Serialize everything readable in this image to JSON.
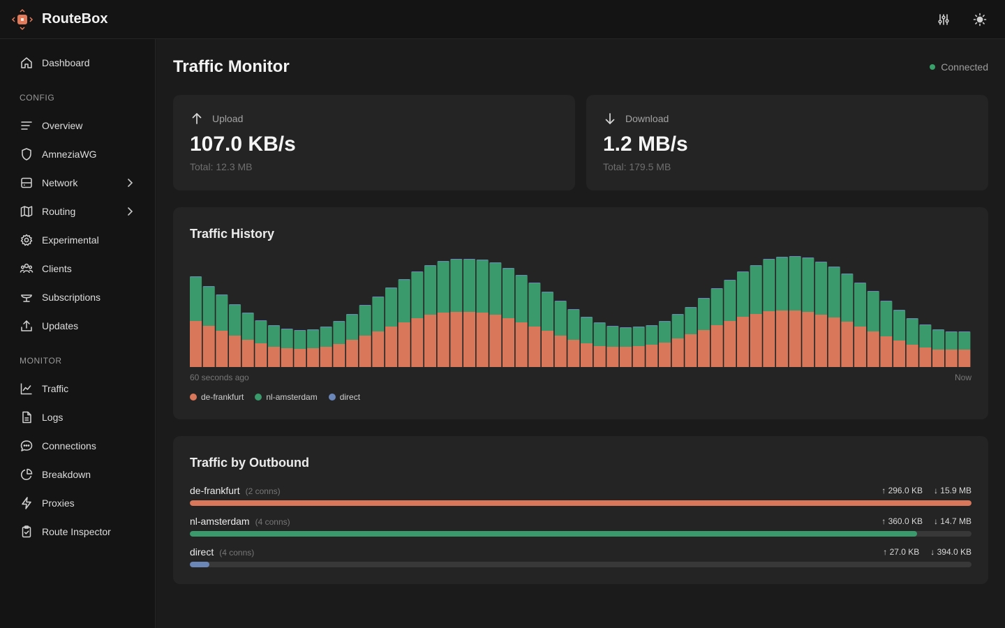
{
  "app": {
    "name": "RouteBox",
    "logo_icon": "routebox-logo-icon",
    "accent": "#e07a5a"
  },
  "topbar": {
    "actions": [
      {
        "icon": "sliders-icon"
      },
      {
        "icon": "sun-icon"
      }
    ]
  },
  "sidebar": {
    "top_items": [
      {
        "label": "Dashboard",
        "icon": "home-icon"
      }
    ],
    "sections": [
      {
        "title": "CONFIG",
        "items": [
          {
            "label": "Overview",
            "icon": "list-icon",
            "chevron": false
          },
          {
            "label": "AmneziaWG",
            "icon": "shield-icon",
            "chevron": false
          },
          {
            "label": "Network",
            "icon": "server-icon",
            "chevron": true
          },
          {
            "label": "Routing",
            "icon": "map-icon",
            "chevron": true
          },
          {
            "label": "Experimental",
            "icon": "gear-icon",
            "chevron": false
          },
          {
            "label": "Clients",
            "icon": "users-icon",
            "chevron": false
          },
          {
            "label": "Subscriptions",
            "icon": "cup-icon",
            "chevron": false
          },
          {
            "label": "Updates",
            "icon": "upload-icon",
            "chevron": false
          }
        ]
      },
      {
        "title": "MONITOR",
        "items": [
          {
            "label": "Traffic",
            "icon": "chart-line-icon",
            "chevron": false
          },
          {
            "label": "Logs",
            "icon": "file-icon",
            "chevron": false
          },
          {
            "label": "Connections",
            "icon": "chat-icon",
            "chevron": false
          },
          {
            "label": "Breakdown",
            "icon": "pie-chart-icon",
            "chevron": false
          },
          {
            "label": "Proxies",
            "icon": "bolt-icon",
            "chevron": false
          },
          {
            "label": "Route Inspector",
            "icon": "clipboard-check-icon",
            "chevron": false
          }
        ]
      }
    ]
  },
  "main": {
    "title": "Traffic Monitor",
    "status": {
      "label": "Connected",
      "color": "#3aa06b"
    },
    "upload": {
      "label": "Upload",
      "value": "107.0 KB/s",
      "total": "Total: 12.3 MB",
      "icon": "arrow-up-icon"
    },
    "download": {
      "label": "Download",
      "value": "1.2 MB/s",
      "total": "Total: 179.5 MB",
      "icon": "arrow-down-icon"
    },
    "history": {
      "title": "Traffic History",
      "axis_left": "60 seconds ago",
      "axis_right": "Now"
    },
    "outbound": {
      "title": "Traffic by Outbound",
      "rows": [
        {
          "name": "de-frankfurt",
          "conns": "(2 conns)",
          "up": "↑ 296.0 KB",
          "down": "↓ 15.9 MB",
          "fill": 1.0,
          "color": "#d9775a"
        },
        {
          "name": "nl-amsterdam",
          "conns": "(4 conns)",
          "up": "↑ 360.0 KB",
          "down": "↓ 14.7 MB",
          "fill": 0.93,
          "color": "#3a9a6b"
        },
        {
          "name": "direct",
          "conns": "(4 conns)",
          "up": "↑ 27.0 KB",
          "down": "↓ 394.0 KB",
          "fill": 0.025,
          "color": "#6b86b8"
        }
      ]
    }
  },
  "chart_data": {
    "type": "bar",
    "stacked": true,
    "series": [
      {
        "name": "de-frankfurt",
        "color": "#d9775a",
        "values": [
          66,
          59,
          52,
          45,
          39,
          34,
          29,
          27,
          26,
          27,
          29,
          33,
          39,
          45,
          51,
          58,
          64,
          70,
          75,
          78,
          79,
          79,
          78,
          75,
          70,
          64,
          58,
          52,
          45,
          39,
          34,
          30,
          29,
          29,
          30,
          32,
          35,
          41,
          47,
          53,
          60,
          66,
          72,
          76,
          80,
          81,
          81,
          79,
          75,
          71,
          65,
          58,
          51,
          44,
          38,
          32,
          28,
          25,
          25,
          25
        ]
      },
      {
        "name": "nl-amsterdam",
        "color": "#3a9a6b",
        "values": [
          63,
          56,
          51,
          44,
          38,
          32,
          30,
          27,
          26,
          26,
          28,
          32,
          36,
          43,
          49,
          55,
          61,
          66,
          70,
          73,
          75,
          75,
          75,
          74,
          71,
          67,
          62,
          55,
          49,
          43,
          37,
          33,
          29,
          27,
          27,
          27,
          30,
          34,
          38,
          45,
          52,
          58,
          64,
          69,
          74,
          76,
          77,
          77,
          75,
          72,
          68,
          62,
          57,
          50,
          43,
          37,
          32,
          28,
          25,
          25
        ]
      },
      {
        "name": "direct",
        "color": "#6b86b8",
        "values": [
          1,
          1,
          1,
          1,
          1,
          1,
          1,
          1,
          1,
          1,
          1,
          1,
          1,
          1,
          1,
          1,
          1,
          1,
          1,
          1,
          1,
          1,
          1,
          1,
          1,
          1,
          1,
          1,
          1,
          1,
          1,
          1,
          1,
          1,
          1,
          1,
          1,
          1,
          1,
          1,
          1,
          1,
          1,
          1,
          1,
          1,
          1,
          1,
          1,
          1,
          1,
          1,
          1,
          1,
          1,
          1,
          1,
          1,
          1,
          1
        ]
      }
    ],
    "legend": [
      "de-frankfurt",
      "nl-amsterdam",
      "direct"
    ],
    "xlabel_left": "60 seconds ago",
    "xlabel_right": "Now",
    "ylim": [
      0,
      165
    ],
    "grid": false,
    "legend_position": "bottom-left"
  }
}
